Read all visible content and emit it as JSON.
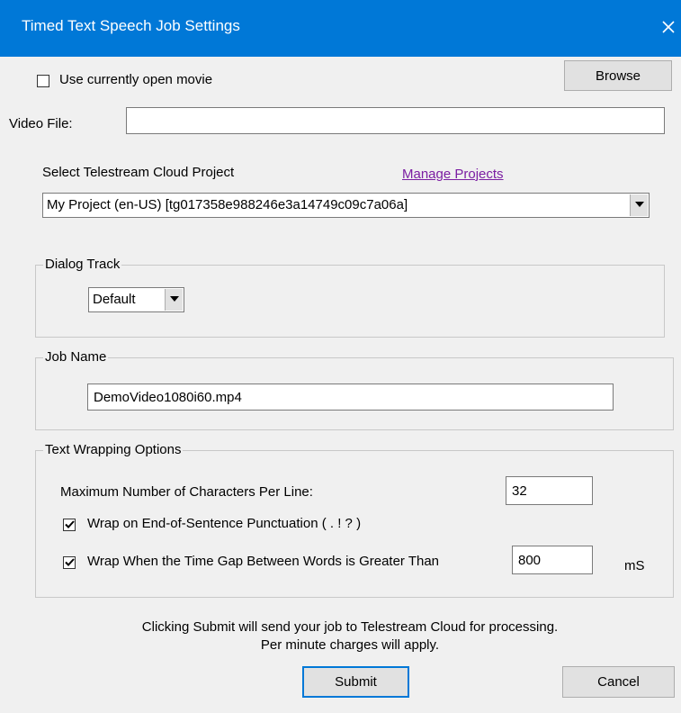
{
  "window": {
    "title": "Timed Text Speech Job Settings"
  },
  "top": {
    "use_open_movie_label": "Use currently open movie",
    "use_open_movie_checked": false,
    "browse_label": "Browse",
    "video_file_label": "Video File:",
    "video_file_value": ""
  },
  "project": {
    "label": "Select Telestream Cloud Project",
    "manage_link": "Manage Projects",
    "selected": "My Project (en-US) [tg017358e988246e3a14749c09c7a06a]"
  },
  "dialog_track": {
    "legend": "Dialog Track",
    "selected": "Default"
  },
  "job_name": {
    "legend": "Job Name",
    "value": "DemoVideo1080i60.mp4"
  },
  "wrapping": {
    "legend": "Text Wrapping Options",
    "max_chars_label": "Maximum Number of Characters Per Line:",
    "max_chars_value": "32",
    "wrap_punct_label": "Wrap on End-of-Sentence Punctuation ( . ! ? )",
    "wrap_punct_checked": true,
    "wrap_gap_label": "Wrap When the Time Gap Between Words is Greater Than",
    "wrap_gap_checked": true,
    "gap_value": "800",
    "gap_unit": "mS"
  },
  "footer": {
    "notice_line1": "Clicking Submit will send your job to Telestream Cloud for processing.",
    "notice_line2": "Per minute charges will apply.",
    "submit_label": "Submit",
    "cancel_label": "Cancel"
  }
}
